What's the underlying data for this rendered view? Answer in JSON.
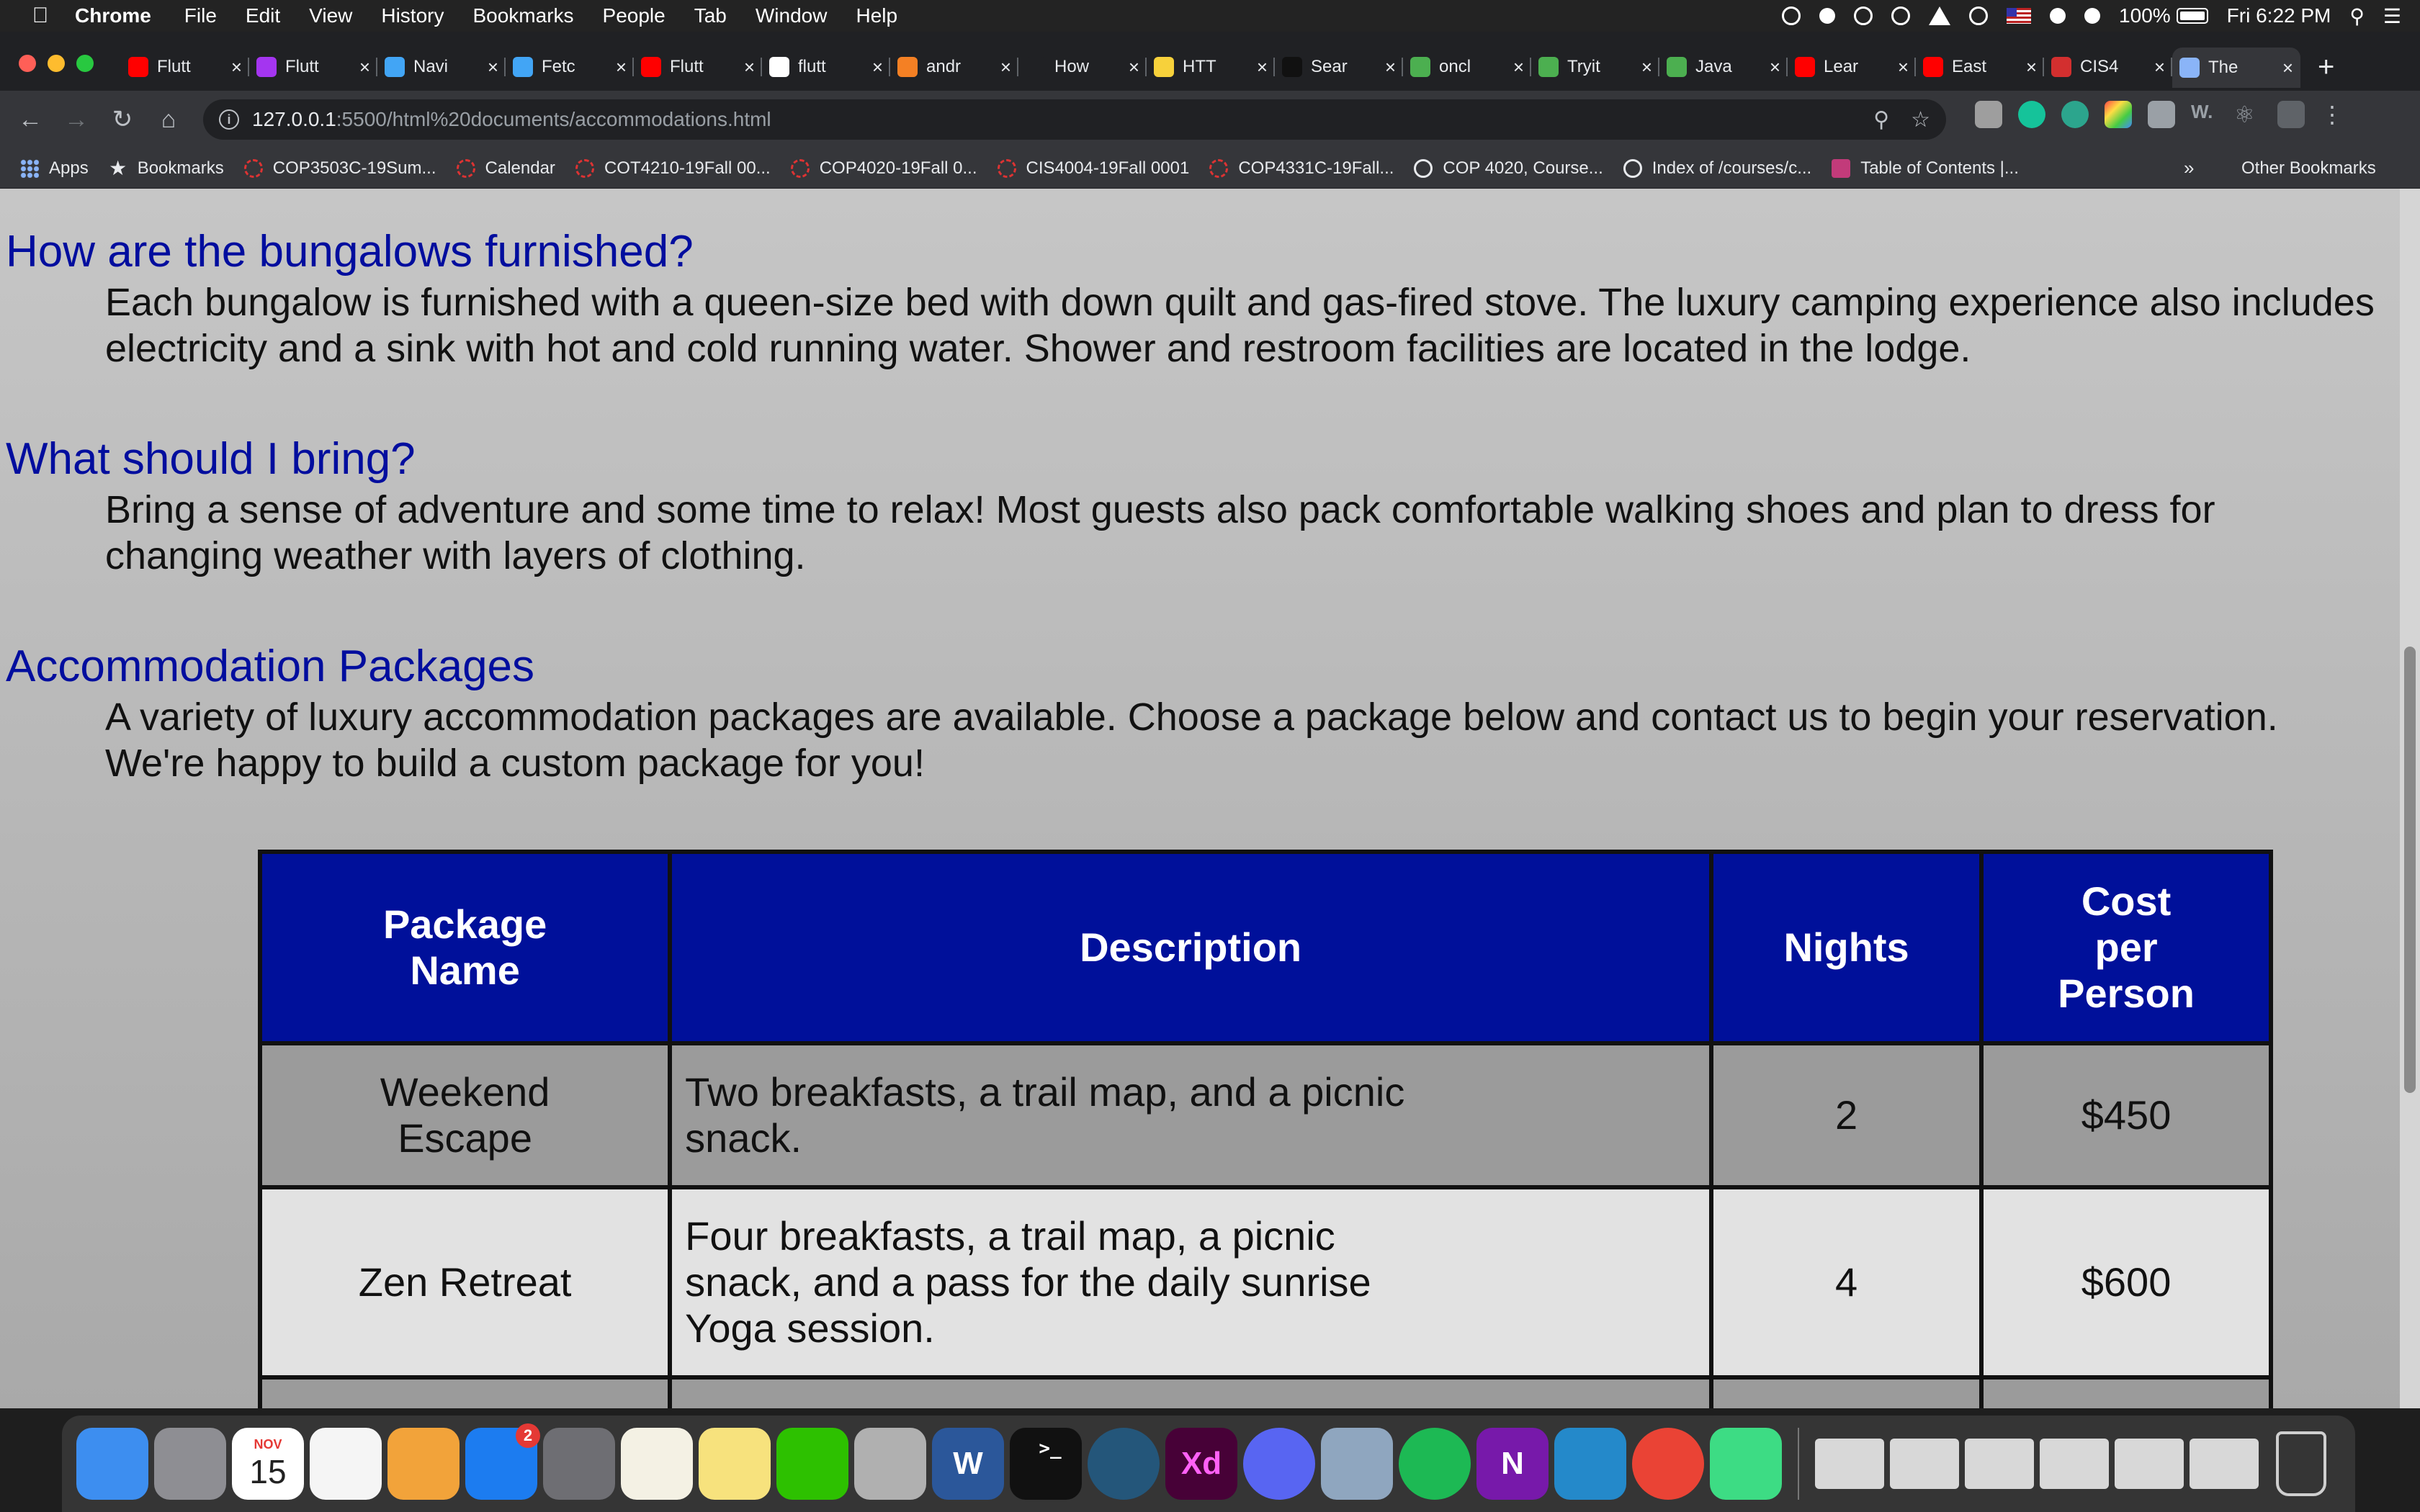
{
  "menubar": {
    "app_name": "Chrome",
    "items": [
      "File",
      "Edit",
      "View",
      "History",
      "Bookmarks",
      "People",
      "Tab",
      "Window",
      "Help"
    ],
    "battery": "100%",
    "clock": "Fri 6:22 PM"
  },
  "tabs": [
    {
      "label": "Flutt",
      "icon": "youtube-icon",
      "color": "#ff0000"
    },
    {
      "label": "Flutt",
      "icon": "udemy-icon",
      "color": "#a435f0"
    },
    {
      "label": "Navi",
      "icon": "flutter-icon",
      "color": "#42a5f5"
    },
    {
      "label": "Fetc",
      "icon": "flutter-icon",
      "color": "#42a5f5"
    },
    {
      "label": "Flutt",
      "icon": "youtube-icon",
      "color": "#ff0000"
    },
    {
      "label": "flutt",
      "icon": "google-icon",
      "color": "#ffffff"
    },
    {
      "label": "andr",
      "icon": "stackoverflow-icon",
      "color": "#f48024"
    },
    {
      "label": "How",
      "icon": "medium-icon",
      "color": "#202124"
    },
    {
      "label": "HTT",
      "icon": "emoji-icon",
      "color": "#f7d13b"
    },
    {
      "label": "Sear",
      "icon": "dark-icon",
      "color": "#111111"
    },
    {
      "label": "oncl",
      "icon": "w3schools-icon",
      "color": "#4caf50"
    },
    {
      "label": "Tryit",
      "icon": "w3schools-icon",
      "color": "#4caf50"
    },
    {
      "label": "Java",
      "icon": "w3schools-icon",
      "color": "#4caf50"
    },
    {
      "label": "Lear",
      "icon": "youtube-icon",
      "color": "#ff0000"
    },
    {
      "label": "East",
      "icon": "youtube-icon",
      "color": "#ff0000"
    },
    {
      "label": "CIS4",
      "icon": "ucf-icon",
      "color": "#d32f2f"
    },
    {
      "label": "The",
      "icon": "page-icon",
      "color": "#8ab4f8",
      "active": true
    }
  ],
  "address": {
    "host": "127.0.0.1",
    "path": ":5500/html%20documents/accommodations.html"
  },
  "bookmarks": [
    {
      "label": "Apps",
      "icon": "grid"
    },
    {
      "label": "Bookmarks",
      "icon": "star"
    },
    {
      "label": "COP3503C-19Sum...",
      "icon": "ucf"
    },
    {
      "label": "Calendar",
      "icon": "ucf"
    },
    {
      "label": "COT4210-19Fall 00...",
      "icon": "ucf"
    },
    {
      "label": "COP4020-19Fall 0...",
      "icon": "ucf"
    },
    {
      "label": "CIS4004-19Fall 0001",
      "icon": "ucf"
    },
    {
      "label": "COP4331C-19Fall...",
      "icon": "ucf"
    },
    {
      "label": "COP 4020, Course...",
      "icon": "globe"
    },
    {
      "label": "Index of /courses/c...",
      "icon": "globe"
    },
    {
      "label": "Table of Contents |...",
      "icon": "toc"
    }
  ],
  "bookmarks_more": "»",
  "bookmarks_other": "Other Bookmarks",
  "faq": [
    {
      "question": "How are the bungalows furnished?",
      "answer": "Each bungalow is furnished with a queen-size bed with down quilt and gas-fired stove. The luxury camping experience also includes electricity and a sink with hot and cold running water. Shower and restroom facilities are located in the lodge."
    },
    {
      "question": "What should I bring?",
      "answer": "Bring a sense of adventure and some time to relax! Most guests also pack comfortable walking shoes and plan to dress for changing weather with layers of clothing."
    },
    {
      "question": "Accommodation Packages",
      "answer": "A variety of luxury accommodation packages are available. Choose a package below and contact us to begin your reservation. We're happy to build a custom package for you!"
    }
  ],
  "table": {
    "headers": [
      "Package Name",
      "Description",
      "Nights",
      "Cost per Person"
    ],
    "rows": [
      {
        "name": "Weekend Escape",
        "description": "Two breakfasts, a trail map, and a picnic snack.",
        "nights": "2",
        "cost": "$450"
      },
      {
        "name": "Zen Retreat",
        "description": "Four breakfasts, a trail map, a picnic snack, and a pass for the daily sunrise Yoga session.",
        "nights": "4",
        "cost": "$600"
      }
    ]
  },
  "dock": {
    "calendar_month": "NOV",
    "calendar_day": "15",
    "appstore_badge": "2",
    "xd_label": "Xd",
    "word_label": "W",
    "onenote_label": "N",
    "items": [
      {
        "name": "finder-icon",
        "color": "#3d8ef0"
      },
      {
        "name": "launchpad-icon",
        "color": "#8e8e93"
      },
      {
        "name": "calendar-icon",
        "color": "#ffffff"
      },
      {
        "name": "reminders-icon",
        "color": "#f5f5f5"
      },
      {
        "name": "photos-icon",
        "color": "#f2a33a"
      },
      {
        "name": "app-store-icon",
        "color": "#1c7cf0"
      },
      {
        "name": "system-preferences-icon",
        "color": "#6e6e73"
      },
      {
        "name": "textedit-icon",
        "color": "#f4f1e4"
      },
      {
        "name": "stickies-icon",
        "color": "#f7e27d"
      },
      {
        "name": "wechat-icon",
        "color": "#2dc100"
      },
      {
        "name": "preview-icon",
        "color": "#b0b0b0"
      },
      {
        "name": "word-icon",
        "color": "#2b579a"
      },
      {
        "name": "terminal-icon",
        "color": "#111111"
      },
      {
        "name": "quicktime-icon",
        "color": "#24567a"
      },
      {
        "name": "adobe-xd-icon",
        "color": "#470137"
      },
      {
        "name": "discord-icon",
        "color": "#5865f2"
      },
      {
        "name": "image-capture-icon",
        "color": "#8fa6bf"
      },
      {
        "name": "spotify-icon",
        "color": "#1db954"
      },
      {
        "name": "onenote-icon",
        "color": "#7719aa"
      },
      {
        "name": "vscode-icon",
        "color": "#2489ca"
      },
      {
        "name": "chrome-icon",
        "color": "#ea4335"
      },
      {
        "name": "android-studio-icon",
        "color": "#3ddc84"
      }
    ]
  }
}
